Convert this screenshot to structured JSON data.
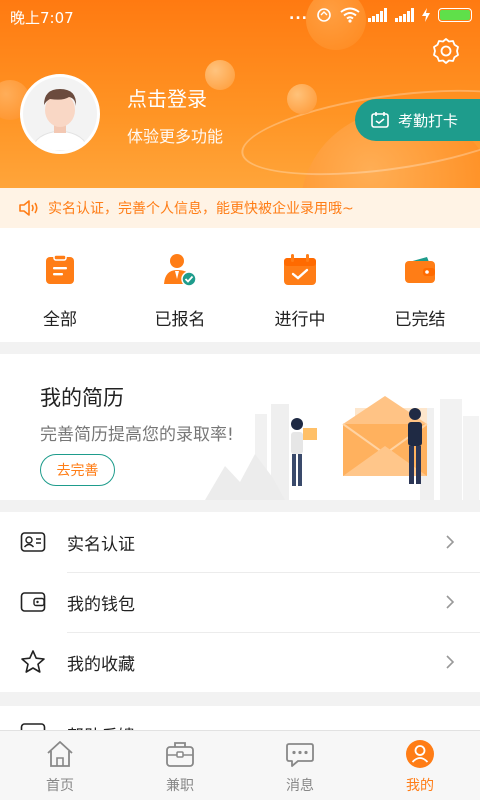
{
  "status_bar": {
    "time": "晚上7:07",
    "dots": "...",
    "battery_level": 1.0
  },
  "header": {
    "login_title": "点击登录",
    "login_subtitle": "体验更多功能",
    "checkin_label": "考勤打卡",
    "settings_icon": "gear-icon",
    "colors": {
      "gradient_top": "#ff7a11",
      "gradient_bottom": "#ffa53a",
      "teal": "#1e9c8c"
    }
  },
  "notice": {
    "text": "实名认证，完善个人信息，能更快被企业录用哦~",
    "icon": "speaker-icon"
  },
  "orders": [
    {
      "label": "全部",
      "icon": "clipboard-icon"
    },
    {
      "label": "已报名",
      "icon": "user-check-icon"
    },
    {
      "label": "进行中",
      "icon": "calendar-check-icon"
    },
    {
      "label": "已完结",
      "icon": "wallet-icon"
    }
  ],
  "resume": {
    "title": "我的简历",
    "subtitle": "完善简历提高您的录取率!",
    "button": "去完善"
  },
  "menu": [
    {
      "label": "实名认证",
      "icon": "id-card-icon"
    },
    {
      "label": "我的钱包",
      "icon": "wallet-outline-icon"
    },
    {
      "label": "我的收藏",
      "icon": "star-icon"
    }
  ],
  "menu_partial": {
    "label": "帮助反馈",
    "icon": "help-icon"
  },
  "bottom_nav": [
    {
      "label": "首页",
      "icon": "home-icon",
      "active": false
    },
    {
      "label": "兼职",
      "icon": "briefcase-icon",
      "active": false
    },
    {
      "label": "消息",
      "icon": "message-icon",
      "active": false
    },
    {
      "label": "我的",
      "icon": "profile-icon",
      "active": true
    }
  ],
  "accent_color": "#ff7d16"
}
